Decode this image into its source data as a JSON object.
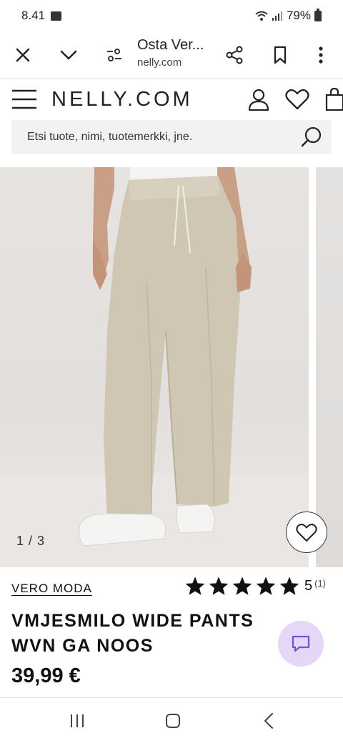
{
  "status_bar": {
    "time": "8.41",
    "battery_percent": "79%",
    "icons": [
      "gallery-icon",
      "wifi-icon",
      "signal-icon",
      "battery-icon"
    ]
  },
  "browser": {
    "page_title": "Osta Ver...",
    "domain": "nelly.com",
    "icons": [
      "close-icon",
      "chevron-down-icon",
      "site-settings-icon",
      "share-icon",
      "bookmark-icon",
      "more-icon"
    ]
  },
  "site": {
    "logo": "NELLY.COM",
    "icons": [
      "menu-icon",
      "account-icon",
      "wishlist-icon",
      "cart-icon"
    ],
    "search": {
      "placeholder": "Etsi tuote, nimi, tuotemerkki, jne."
    }
  },
  "gallery": {
    "counter": "1 / 3",
    "current": 1,
    "total": 3
  },
  "product": {
    "brand": "VERO MODA",
    "rating_value": "5",
    "rating_count": "(1)",
    "stars": 5,
    "title": "VMJESMILO WIDE PANTS WVN GA NOOS",
    "price": "39,99 €"
  },
  "colors": {
    "chat_button": "#e4d8f6",
    "chat_icon": "#7a4fd0",
    "stars": "#111111"
  },
  "nav": {
    "icons": [
      "recents-icon",
      "home-icon",
      "back-icon"
    ]
  }
}
